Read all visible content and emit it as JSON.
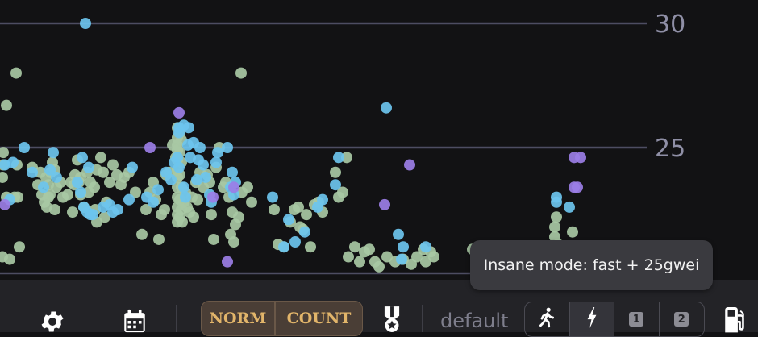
{
  "chart_data": {
    "type": "scatter",
    "y_ticks": [
      "30",
      "25"
    ],
    "ylim": [
      19.8,
      31.0
    ],
    "legend": "none",
    "grid": true,
    "colors": {
      "green": "#a8c8a4",
      "blue": "#6cc4ee",
      "purple": "#9b7ee6"
    },
    "series": [
      {
        "color_key": "green",
        "points": [
          [
            8,
            26.7
          ],
          [
            20,
            28.0
          ],
          [
            4,
            24.8
          ],
          [
            4,
            24.3
          ],
          [
            3,
            23.8
          ],
          [
            21,
            24.3
          ],
          [
            18,
            23.0
          ],
          [
            22,
            23.0
          ],
          [
            8,
            23.0
          ],
          [
            3,
            20.6
          ],
          [
            12,
            20.5
          ],
          [
            24,
            21.0
          ],
          [
            40,
            24.2
          ],
          [
            50,
            24.0
          ],
          [
            47,
            23.5
          ],
          [
            52,
            23.1
          ],
          [
            63,
            24.0
          ],
          [
            57,
            23.8
          ],
          [
            65,
            24.4
          ],
          [
            68,
            24.1
          ],
          [
            60,
            23.5
          ],
          [
            60,
            23.0
          ],
          [
            55,
            22.8
          ],
          [
            58,
            22.6
          ],
          [
            62,
            23.1
          ],
          [
            70,
            23.4
          ],
          [
            68,
            22.5
          ],
          [
            75,
            23.6
          ],
          [
            78,
            23.0
          ],
          [
            84,
            23.1
          ],
          [
            88,
            23.6
          ],
          [
            90,
            22.4
          ],
          [
            93,
            23.9
          ],
          [
            96,
            24.5
          ],
          [
            92,
            23.5
          ],
          [
            100,
            23.1
          ],
          [
            98,
            23.6
          ],
          [
            100,
            23.8
          ],
          [
            104,
            22.6
          ],
          [
            108,
            24.0
          ],
          [
            110,
            23.2
          ],
          [
            112,
            23.6
          ],
          [
            117,
            23.4
          ],
          [
            120,
            24.1
          ],
          [
            125,
            24.6
          ],
          [
            128,
            24.0
          ],
          [
            118,
            22.5
          ],
          [
            132,
            22.8
          ],
          [
            130,
            22.2
          ],
          [
            120,
            22.0
          ],
          [
            140,
            24.3
          ],
          [
            136,
            23.6
          ],
          [
            145,
            23.9
          ],
          [
            150,
            23.5
          ],
          [
            154,
            23.8
          ],
          [
            160,
            24.0
          ],
          [
            168,
            23.2
          ],
          [
            176,
            21.5
          ],
          [
            181,
            22.5
          ],
          [
            186,
            23.2
          ],
          [
            190,
            23.6
          ],
          [
            193,
            22.9
          ],
          [
            197,
            21.3
          ],
          [
            200,
            22.3
          ],
          [
            204,
            22.5
          ],
          [
            206,
            23.9
          ],
          [
            210,
            24.0
          ],
          [
            214,
            25.1
          ],
          [
            218,
            24.6
          ],
          [
            220,
            25.8
          ],
          [
            220,
            25.4
          ],
          [
            220,
            25.1
          ],
          [
            220,
            24.9
          ],
          [
            220,
            24.5
          ],
          [
            220,
            24.1
          ],
          [
            220,
            23.8
          ],
          [
            220,
            23.4
          ],
          [
            220,
            23.0
          ],
          [
            220,
            22.6
          ],
          [
            220,
            22.3
          ],
          [
            220,
            22.0
          ],
          [
            223,
            25.6
          ],
          [
            225,
            25.3
          ],
          [
            223,
            24.8
          ],
          [
            225,
            24.4
          ],
          [
            223,
            23.9
          ],
          [
            225,
            23.4
          ],
          [
            223,
            22.9
          ],
          [
            225,
            22.5
          ],
          [
            223,
            22.2
          ],
          [
            226,
            22.0
          ],
          [
            228,
            22.8
          ],
          [
            230,
            23.2
          ],
          [
            232,
            22.6
          ],
          [
            235,
            22.4
          ],
          [
            238,
            23.0
          ],
          [
            240,
            22.2
          ],
          [
            243,
            23.6
          ],
          [
            245,
            22.9
          ],
          [
            248,
            24.0
          ],
          [
            252,
            23.4
          ],
          [
            257,
            23.9
          ],
          [
            260,
            23.6
          ],
          [
            262,
            22.3
          ],
          [
            265,
            21.3
          ],
          [
            272,
            25.0
          ],
          [
            268,
            24.2
          ],
          [
            277,
            23.4
          ],
          [
            280,
            23.6
          ],
          [
            284,
            23.0
          ],
          [
            288,
            22.4
          ],
          [
            292,
            21.9
          ],
          [
            286,
            21.5
          ],
          [
            290,
            21.2
          ],
          [
            296,
            22.2
          ],
          [
            299,
            28.0
          ],
          [
            300,
            23.2
          ],
          [
            307,
            23.4
          ],
          [
            312,
            22.8
          ],
          [
            340,
            22.5
          ],
          [
            345,
            21.1
          ],
          [
            352,
            21.0
          ],
          [
            360,
            22.0
          ],
          [
            365,
            22.5
          ],
          [
            370,
            22.6
          ],
          [
            372,
            21.8
          ],
          [
            376,
            21.7
          ],
          [
            380,
            22.3
          ],
          [
            385,
            21.0
          ],
          [
            390,
            22.7
          ],
          [
            395,
            22.8
          ],
          [
            400,
            22.4
          ],
          [
            416,
            24.0
          ],
          [
            420,
            23.0
          ],
          [
            425,
            23.2
          ],
          [
            430,
            24.6
          ],
          [
            432,
            20.6
          ],
          [
            440,
            21.0
          ],
          [
            446,
            20.4
          ],
          [
            452,
            20.8
          ],
          [
            458,
            20.9
          ],
          [
            465,
            20.4
          ],
          [
            470,
            20.2
          ],
          [
            480,
            20.6
          ],
          [
            490,
            20.4
          ],
          [
            500,
            20.5
          ],
          [
            510,
            20.3
          ],
          [
            517,
            20.6
          ],
          [
            525,
            20.9
          ],
          [
            528,
            20.4
          ],
          [
            534,
            20.8
          ],
          [
            538,
            20.6
          ],
          [
            586,
            20.9
          ],
          [
            593,
            20.4
          ],
          [
            610,
            21.0
          ],
          [
            622,
            20.8
          ],
          [
            640,
            20.5
          ],
          [
            650,
            20.8
          ],
          [
            660,
            20.6
          ],
          [
            672,
            20.9
          ],
          [
            688,
            21.4
          ],
          [
            688,
            21.8
          ],
          [
            690,
            22.2
          ],
          [
            692,
            21.1
          ],
          [
            700,
            20.7
          ],
          [
            710,
            21.6
          ]
        ]
      },
      {
        "color_key": "blue",
        "points": [
          [
            106,
            30.0
          ],
          [
            479,
            26.6
          ],
          [
            30,
            25.0
          ],
          [
            12,
            22.9
          ],
          [
            6,
            24.3
          ],
          [
            16,
            24.4
          ],
          [
            40,
            24.0
          ],
          [
            66,
            24.8
          ],
          [
            54,
            23.4
          ],
          [
            62,
            24.1
          ],
          [
            70,
            23.8
          ],
          [
            100,
            23.2
          ],
          [
            102,
            24.6
          ],
          [
            110,
            24.2
          ],
          [
            96,
            23.6
          ],
          [
            104,
            22.6
          ],
          [
            108,
            22.4
          ],
          [
            112,
            22.3
          ],
          [
            115,
            22.3
          ],
          [
            128,
            22.6
          ],
          [
            136,
            22.7
          ],
          [
            140,
            22.4
          ],
          [
            146,
            22.5
          ],
          [
            160,
            22.9
          ],
          [
            164,
            24.2
          ],
          [
            182,
            23.0
          ],
          [
            190,
            22.8
          ],
          [
            196,
            23.3
          ],
          [
            206,
            24.0
          ],
          [
            212,
            23.7
          ],
          [
            216,
            24.4
          ],
          [
            220,
            24.6
          ],
          [
            222,
            25.6
          ],
          [
            222,
            25.8
          ],
          [
            228,
            25.9
          ],
          [
            234,
            25.8
          ],
          [
            233,
            25.1
          ],
          [
            222,
            24.2
          ],
          [
            228,
            23.4
          ],
          [
            230,
            23.0
          ],
          [
            236,
            24.6
          ],
          [
            240,
            25.2
          ],
          [
            244,
            23.7
          ],
          [
            246,
            24.5
          ],
          [
            248,
            25.0
          ],
          [
            252,
            24.3
          ],
          [
            255,
            23.8
          ],
          [
            260,
            23.1
          ],
          [
            262,
            22.8
          ],
          [
            268,
            24.4
          ],
          [
            270,
            24.8
          ],
          [
            282,
            25.0
          ],
          [
            286,
            23.4
          ],
          [
            290,
            23.1
          ],
          [
            288,
            24.0
          ],
          [
            292,
            23.6
          ],
          [
            338,
            23.0
          ],
          [
            352,
            21.0
          ],
          [
            358,
            22.1
          ],
          [
            366,
            21.2
          ],
          [
            378,
            21.6
          ],
          [
            394,
            22.6
          ],
          [
            400,
            22.9
          ],
          [
            416,
            23.5
          ],
          [
            420,
            24.6
          ],
          [
            494,
            21.5
          ],
          [
            498,
            20.5
          ],
          [
            500,
            21.0
          ],
          [
            528,
            21.0
          ],
          [
            690,
            22.8
          ],
          [
            690,
            23.0
          ],
          [
            706,
            22.6
          ]
        ]
      },
      {
        "color_key": "purple",
        "points": [
          [
            222,
            26.4
          ],
          [
            186,
            25.0
          ],
          [
            6,
            22.7
          ],
          [
            264,
            23.0
          ],
          [
            290,
            23.4
          ],
          [
            282,
            20.4
          ],
          [
            477,
            22.7
          ],
          [
            508,
            24.3
          ],
          [
            712,
            24.6
          ],
          [
            720,
            24.6
          ],
          [
            712,
            23.4
          ],
          [
            716,
            23.4
          ]
        ]
      }
    ]
  },
  "tooltip": {
    "text": "Insane mode: fast + 25gwei"
  },
  "toolbar": {
    "norm_label": "NORM",
    "count_label": "COUNT",
    "profile_label": "default",
    "mode_1": "1",
    "mode_2": "2",
    "icons": [
      "gear-icon",
      "calendar-icon",
      "medal-icon",
      "walk-icon",
      "lightning-icon",
      "fuel-pump-icon"
    ]
  }
}
